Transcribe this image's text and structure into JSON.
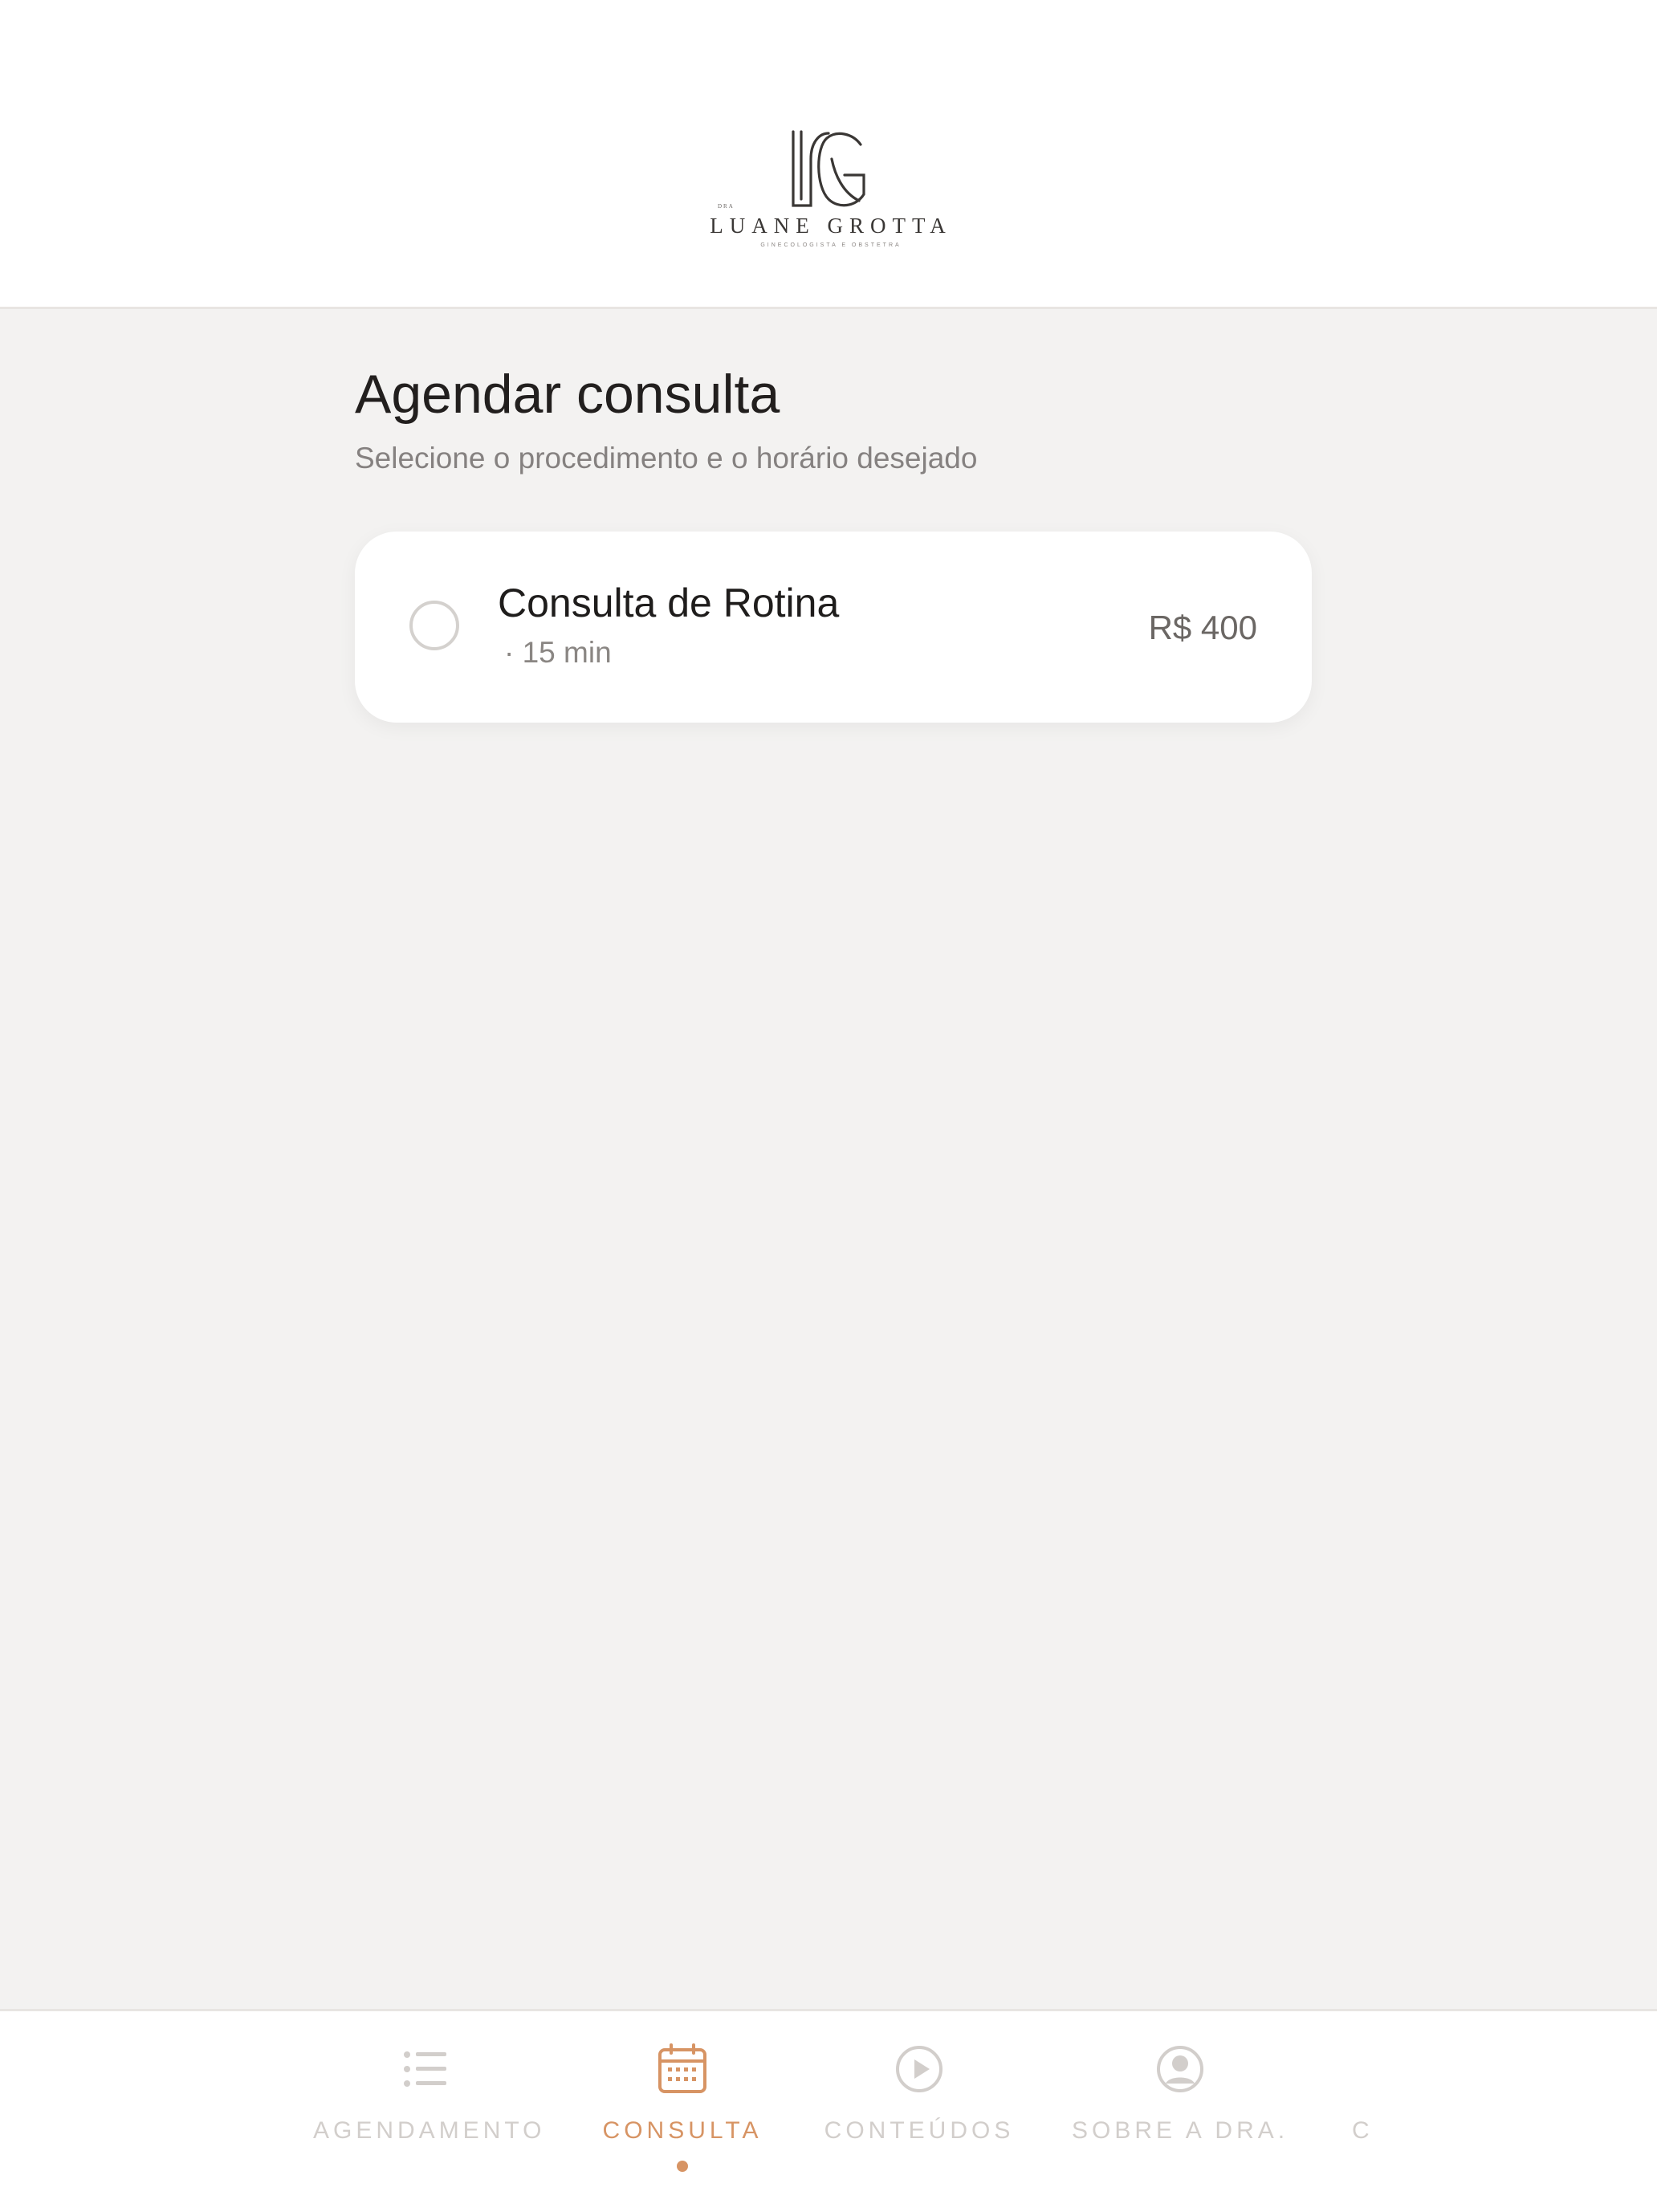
{
  "brand": {
    "small_prefix": "DRA",
    "name": "LUANE GROTTA",
    "tagline": "GINECOLOGISTA E OBSTETRA"
  },
  "page": {
    "title": "Agendar consulta",
    "subtitle": "Selecione o procedimento e o horário desejado"
  },
  "services": [
    {
      "name": "Consulta de Rotina",
      "duration": "· 15 min",
      "price": "R$ 400",
      "selected": false
    }
  ],
  "tabs": [
    {
      "label": "AGENDAMENTO",
      "icon": "list-icon",
      "active": false
    },
    {
      "label": "CONSULTA",
      "icon": "calendar-icon",
      "active": true
    },
    {
      "label": "CONTEÚDOS",
      "icon": "play-icon",
      "active": false
    },
    {
      "label": "SOBRE A DRA.",
      "icon": "user-circle-icon",
      "active": false
    }
  ],
  "colors": {
    "background": "#f3f2f1",
    "surface": "#ffffff",
    "accent": "#d79464",
    "inactive": "#d2cecb"
  }
}
